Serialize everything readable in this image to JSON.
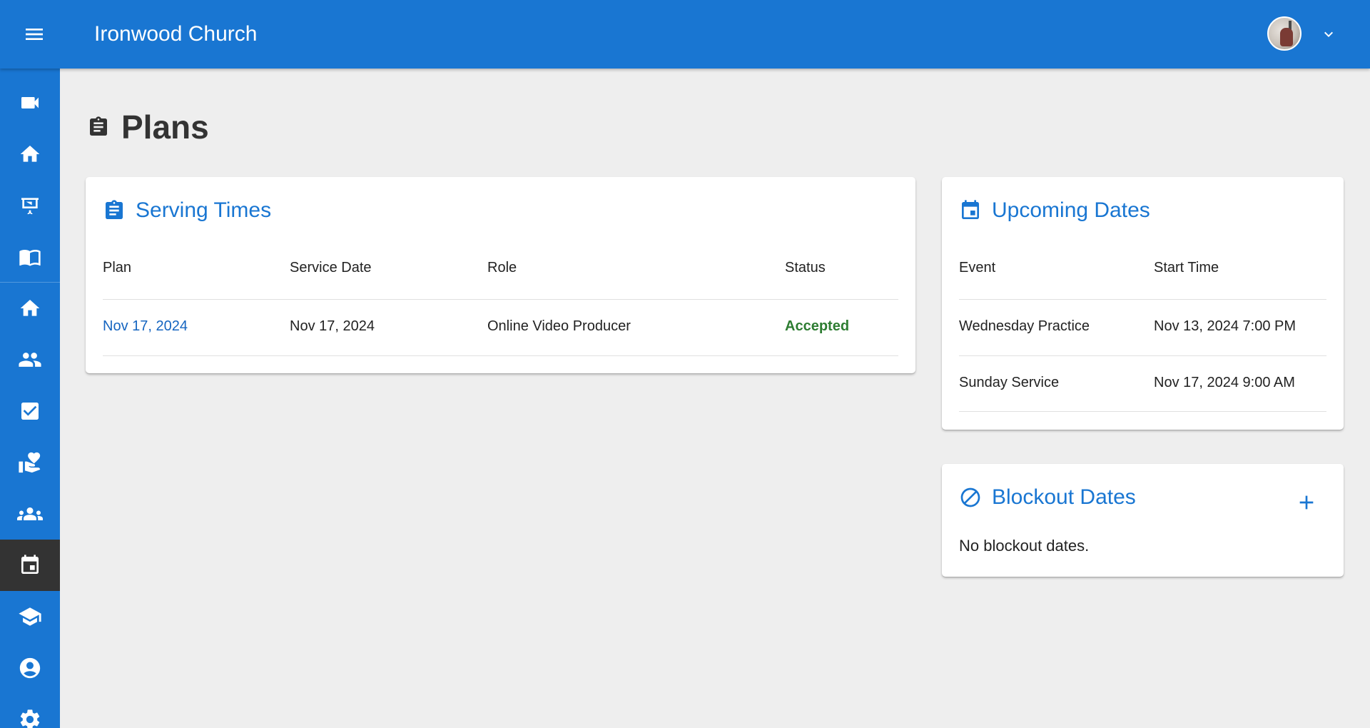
{
  "header": {
    "title": "Ironwood Church",
    "menu_icon": "hamburger-menu-icon",
    "avatar": "user-avatar",
    "dropdown_icon": "chevron-down-icon"
  },
  "sidebar": {
    "items": [
      {
        "name": "video",
        "icon": "video-camera-icon",
        "active": false
      },
      {
        "name": "home",
        "icon": "home-icon",
        "active": false
      },
      {
        "name": "sermons",
        "icon": "projector-screen-icon",
        "active": false
      },
      {
        "name": "bible",
        "icon": "open-book-icon",
        "active": false
      },
      {
        "name": "church-home",
        "icon": "home-icon",
        "active": false
      },
      {
        "name": "people",
        "icon": "people-icon",
        "active": false
      },
      {
        "name": "tasks",
        "icon": "checkbox-icon",
        "active": false
      },
      {
        "name": "donations",
        "icon": "volunteer-heart-icon",
        "active": false
      },
      {
        "name": "groups",
        "icon": "groups-icon",
        "active": false
      },
      {
        "name": "plans",
        "icon": "calendar-icon",
        "active": true
      },
      {
        "name": "lessons",
        "icon": "graduation-cap-icon",
        "active": false
      },
      {
        "name": "profile",
        "icon": "account-circle-icon",
        "active": false
      },
      {
        "name": "settings",
        "icon": "gear-icon",
        "active": false
      }
    ]
  },
  "page": {
    "title": "Plans",
    "title_icon": "clipboard-icon"
  },
  "serving_times": {
    "title": "Serving Times",
    "columns": [
      "Plan",
      "Service Date",
      "Role",
      "Status"
    ],
    "rows": [
      {
        "plan": "Nov 17, 2024",
        "service_date": "Nov 17, 2024",
        "role": "Online Video Producer",
        "status": "Accepted"
      }
    ]
  },
  "upcoming_dates": {
    "title": "Upcoming Dates",
    "columns": [
      "Event",
      "Start Time"
    ],
    "rows": [
      {
        "event": "Wednesday Practice",
        "start_time": "Nov 13, 2024 7:00 PM"
      },
      {
        "event": "Sunday Service",
        "start_time": "Nov 17, 2024 9:00 AM"
      }
    ]
  },
  "blockout_dates": {
    "title": "Blockout Dates",
    "empty_text": "No blockout dates.",
    "add_icon": "plus-icon"
  },
  "colors": {
    "primary": "#1976d2",
    "sidebar_active": "#333333",
    "status_accepted": "#2e7d32",
    "background": "#eeeeee"
  }
}
